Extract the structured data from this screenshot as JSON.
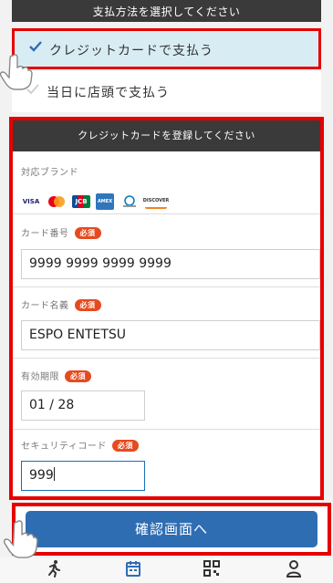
{
  "payment": {
    "header": "支払方法を選択してください",
    "options": [
      {
        "label": "クレジットカードで支払う",
        "selected": true
      },
      {
        "label": "当日に店頭で支払う",
        "selected": false
      }
    ]
  },
  "card_form": {
    "header": "クレジットカードを登録してください",
    "brands_label": "対応ブランド",
    "brands": [
      "VISA",
      "Mastercard",
      "JCB",
      "AMERICAN EXPRESS",
      "Diners Club",
      "DISCOVER"
    ],
    "required_badge": "必須",
    "number_label": "カード番号",
    "number_value": "9999 9999 9999 9999",
    "name_label": "カード名義",
    "name_value": "ESPO ENTETSU",
    "expiry_label": "有効期限",
    "expiry_value": "01 / 28",
    "cvc_label": "セキュリティコード",
    "cvc_value": "999"
  },
  "confirm_button": "確認画面へ",
  "bottom_nav": {
    "items": [
      "run-icon",
      "calendar-icon",
      "qr-code-icon",
      "user-icon"
    ],
    "accent": "#2f6db3"
  },
  "colors": {
    "highlight": "#e60000",
    "primary": "#2f6db3",
    "selected_bg": "#d8edf3",
    "required": "#e64a1e"
  }
}
